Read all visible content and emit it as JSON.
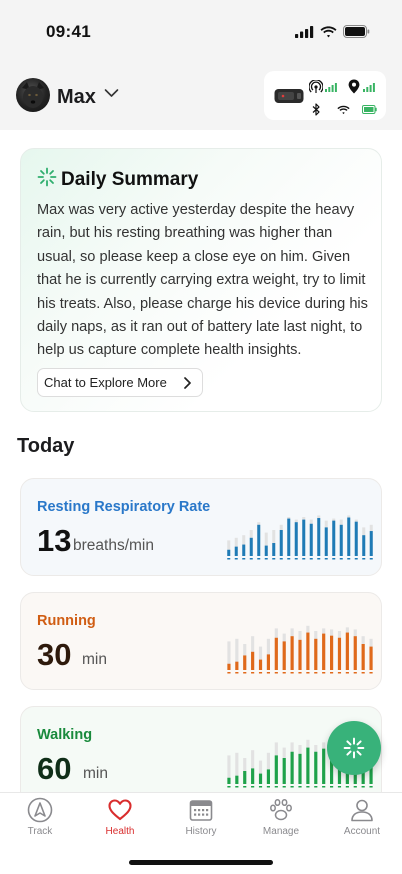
{
  "status_bar": {
    "time": "09:41"
  },
  "header": {
    "pet_name": "Max"
  },
  "summary": {
    "title": "Daily Summary",
    "text": "Max was very active yesterday despite the heavy rain, but his resting breathing was higher than usual, so please keep a close eye on him. Given that he is currently carrying extra weight, try to limit his treats. Also, please charge his device during his daily naps, as it ran out of battery late last night, to help us capture complete health insights.",
    "button_label": "Chat to Explore More"
  },
  "section_title": "Today",
  "metrics": [
    {
      "label": "Resting Respiratory Rate",
      "value": "13",
      "unit": "breaths/min",
      "color": "#2a78c9",
      "value_color": "#111111",
      "bar_color": "#1f7bb6",
      "bars": [
        0.12,
        0.18,
        0.22,
        0.35,
        0.6,
        0.2,
        0.25,
        0.5,
        0.72,
        0.65,
        0.7,
        0.62,
        0.73,
        0.55,
        0.68,
        0.6,
        0.74,
        0.66,
        0.4,
        0.48
      ],
      "ghost": [
        0.3,
        0.35,
        0.4,
        0.5,
        0.65,
        0.45,
        0.5,
        0.6,
        0.75,
        0.7,
        0.75,
        0.7,
        0.78,
        0.68,
        0.72,
        0.7,
        0.78,
        0.7,
        0.55,
        0.6
      ]
    },
    {
      "label": "Running",
      "value": "30",
      "unit": "min",
      "color": "#d05d13",
      "value_color": "#2e1a0c",
      "bar_color": "#e0691a",
      "bars": [
        0.12,
        0.16,
        0.28,
        0.35,
        0.2,
        0.3,
        0.62,
        0.55,
        0.65,
        0.58,
        0.72,
        0.6,
        0.7,
        0.66,
        0.62,
        0.72,
        0.65,
        0.5,
        0.45
      ],
      "ghost": [
        0.55,
        0.6,
        0.5,
        0.65,
        0.45,
        0.6,
        0.8,
        0.7,
        0.8,
        0.75,
        0.85,
        0.75,
        0.8,
        0.78,
        0.75,
        0.82,
        0.78,
        0.65,
        0.6
      ]
    },
    {
      "label": "Walking",
      "value": "60",
      "unit": "min",
      "color": "#198a3c",
      "value_color": "#0f2e18",
      "bar_color": "#1ea24a",
      "bars": [
        0.12,
        0.16,
        0.25,
        0.3,
        0.2,
        0.28,
        0.55,
        0.5,
        0.62,
        0.58,
        0.7,
        0.62,
        0.68,
        0.66,
        0.6,
        0.7,
        0.65,
        0.48,
        0.42
      ],
      "ghost": [
        0.55,
        0.6,
        0.5,
        0.65,
        0.45,
        0.6,
        0.8,
        0.7,
        0.8,
        0.75,
        0.85,
        0.75,
        0.8,
        0.78,
        0.75,
        0.82,
        0.78,
        0.65,
        0.6
      ]
    }
  ],
  "tabs": [
    {
      "label": "Track",
      "icon": "compass-icon",
      "active": false
    },
    {
      "label": "Health",
      "icon": "heart-icon",
      "active": true
    },
    {
      "label": "History",
      "icon": "calendar-icon",
      "active": false
    },
    {
      "label": "Manage",
      "icon": "paw-icon",
      "active": false
    },
    {
      "label": "Account",
      "icon": "person-icon",
      "active": false
    }
  ],
  "colors": {
    "accent_green": "#38b27a",
    "active_tab": "#d92d2d"
  }
}
